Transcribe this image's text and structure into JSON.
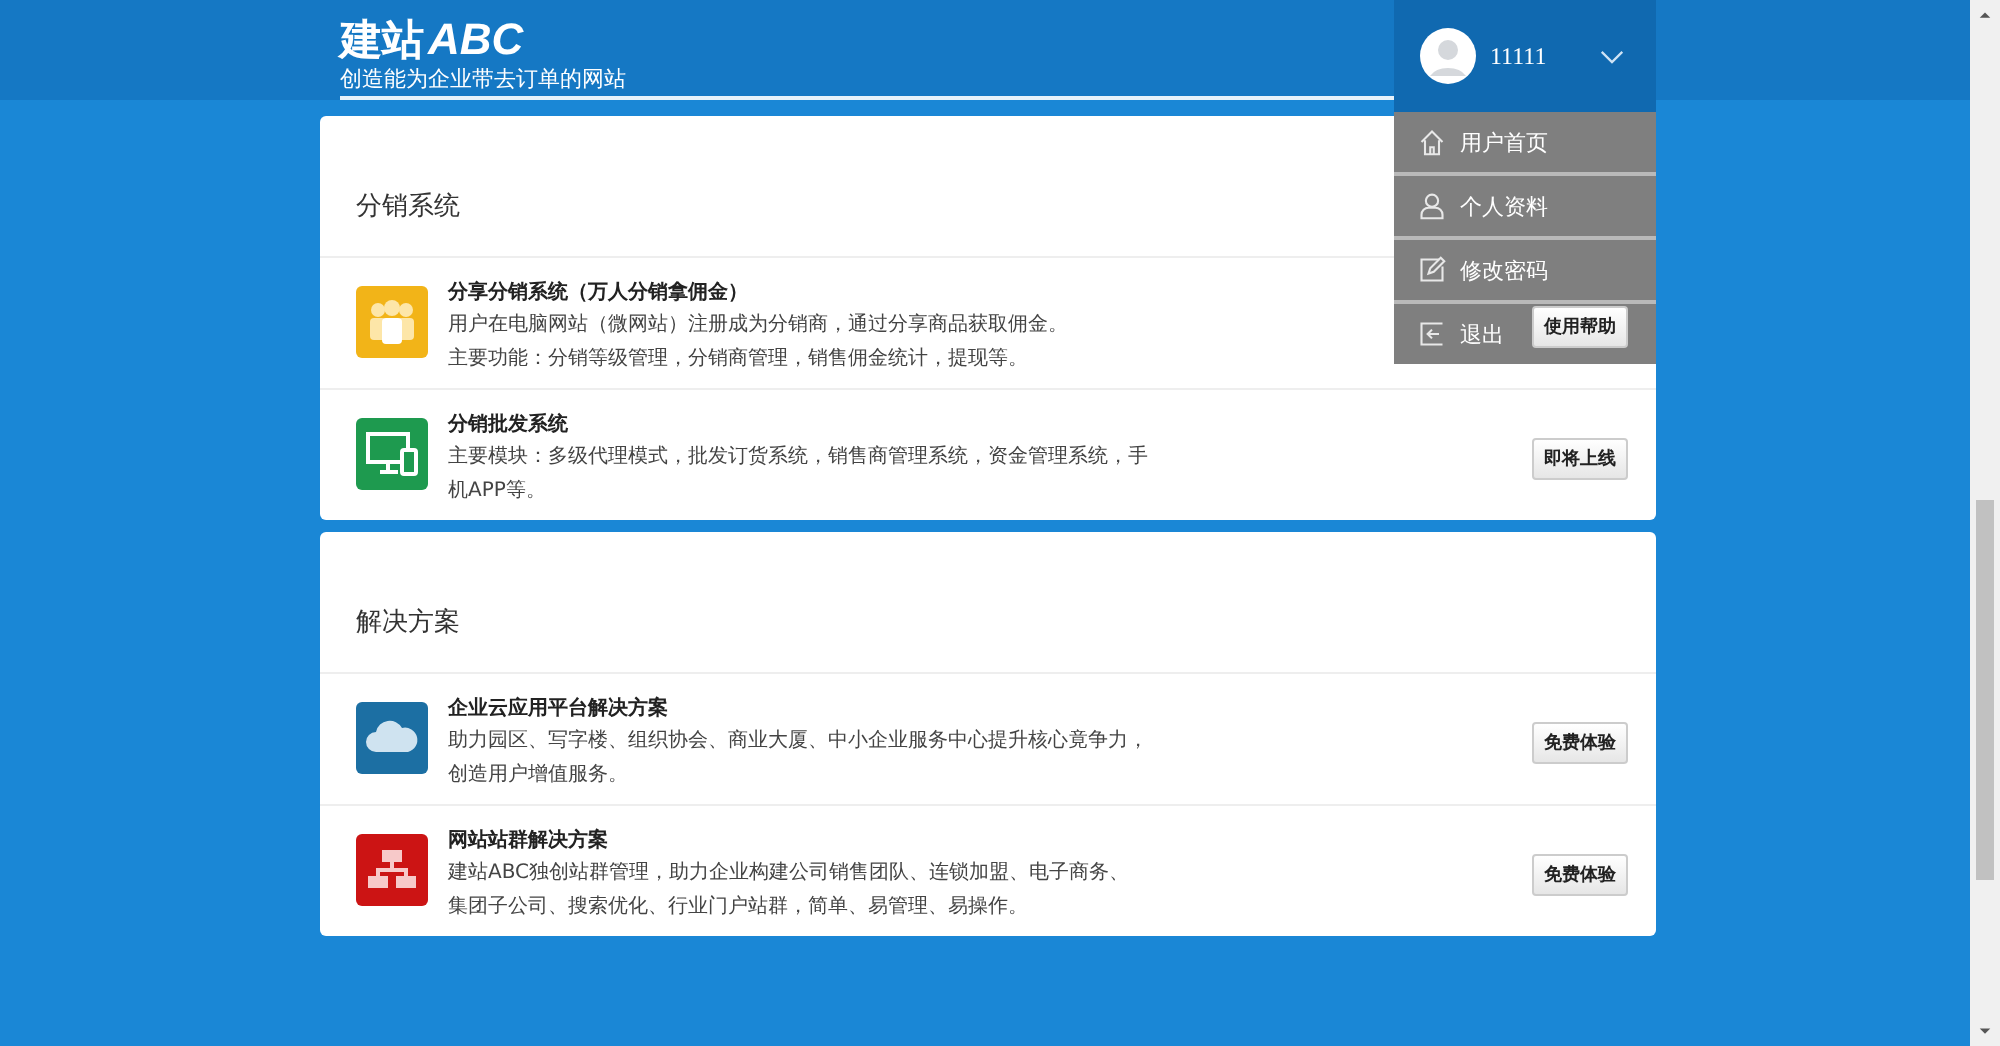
{
  "header": {
    "logo_main": "建站",
    "logo_accent": "ABC",
    "slogan": "创造能为企业带去订单的网站"
  },
  "user_menu": {
    "username": "11111",
    "expanded": true,
    "items": [
      {
        "kind": "home",
        "label": "用户首页"
      },
      {
        "kind": "profile",
        "label": "个人资料"
      },
      {
        "kind": "password",
        "label": "修改密码"
      },
      {
        "kind": "logout",
        "label": "退出"
      }
    ]
  },
  "sections": [
    {
      "title": "分销系统",
      "items": [
        {
          "kind": "share",
          "title": "分享分销系统（万人分销拿佣金）",
          "lines": [
            "用户在电脑网站（微网站）注册成为分销商，通过分享商品获取佣金。",
            "主要功能：分销等级管理，分销商管理，销售佣金统计，提现等。"
          ],
          "button": "使用帮助"
        },
        {
          "kind": "wholesale",
          "title": "分销批发系统",
          "lines": [
            "主要模块：多级代理模式，批发订货系统，销售商管理系统，资金管理系统，手机APP等。"
          ],
          "button": "即将上线"
        }
      ]
    },
    {
      "title": "解决方案",
      "items": [
        {
          "kind": "cloud",
          "title": "企业云应用平台解决方案",
          "lines": [
            "助力园区、写字楼、组织协会、商业大厦、中小企业服务中心提升核心竟争力，创造用户增值服务。"
          ],
          "button": "免费体验"
        },
        {
          "kind": "sites",
          "title": "网站站群解决方案",
          "lines": [
            "建站ABC独创站群管理，助力企业构建公司销售团队、连锁加盟、电子商务、集团子公司、搜索优化、行业门户站群，简单、易管理、易操作。"
          ],
          "button": "免费体验"
        }
      ]
    }
  ]
}
